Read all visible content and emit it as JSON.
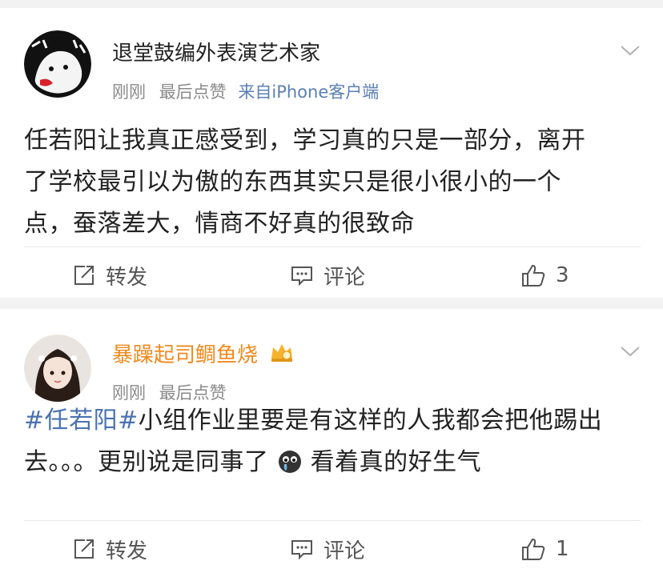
{
  "posts": [
    {
      "username": "退堂鼓编外表演艺术家",
      "time": "刚刚",
      "liked_label": "最后点赞",
      "source": "来自iPhone客户端",
      "text_lines": [
        "任若阳让我真正感受到，学习真的只是一部分，离开",
        "了学校最引以为傲的东西其实只是很小很小的一个",
        "点，蚕落差大，情商不好真的很致命"
      ],
      "actions": {
        "repost": "转发",
        "comment": "评论",
        "likes": "3"
      }
    },
    {
      "username": "暴躁起司鲷鱼烧",
      "time": "刚刚",
      "liked_label": "最后点赞",
      "topic": "#任若阳#",
      "text_line1_rest": "小组作业里要是有这样的人我都会把他踢出",
      "text_line2_a": "去。。。更别说是同事了",
      "text_line2_b": "看着真的好生气",
      "actions": {
        "repost": "转发",
        "comment": "评论",
        "likes": "1"
      }
    }
  ],
  "colors": {
    "background": "#f2f2f2",
    "card": "#ffffff",
    "vip_username": "#f08a1e",
    "topic_link": "#4a72b0",
    "meta_gray": "#8a8a8a"
  },
  "icons": [
    "chevron-down-icon",
    "repost-icon",
    "comment-icon",
    "like-icon",
    "crown-icon",
    "crying-emoji-icon"
  ]
}
